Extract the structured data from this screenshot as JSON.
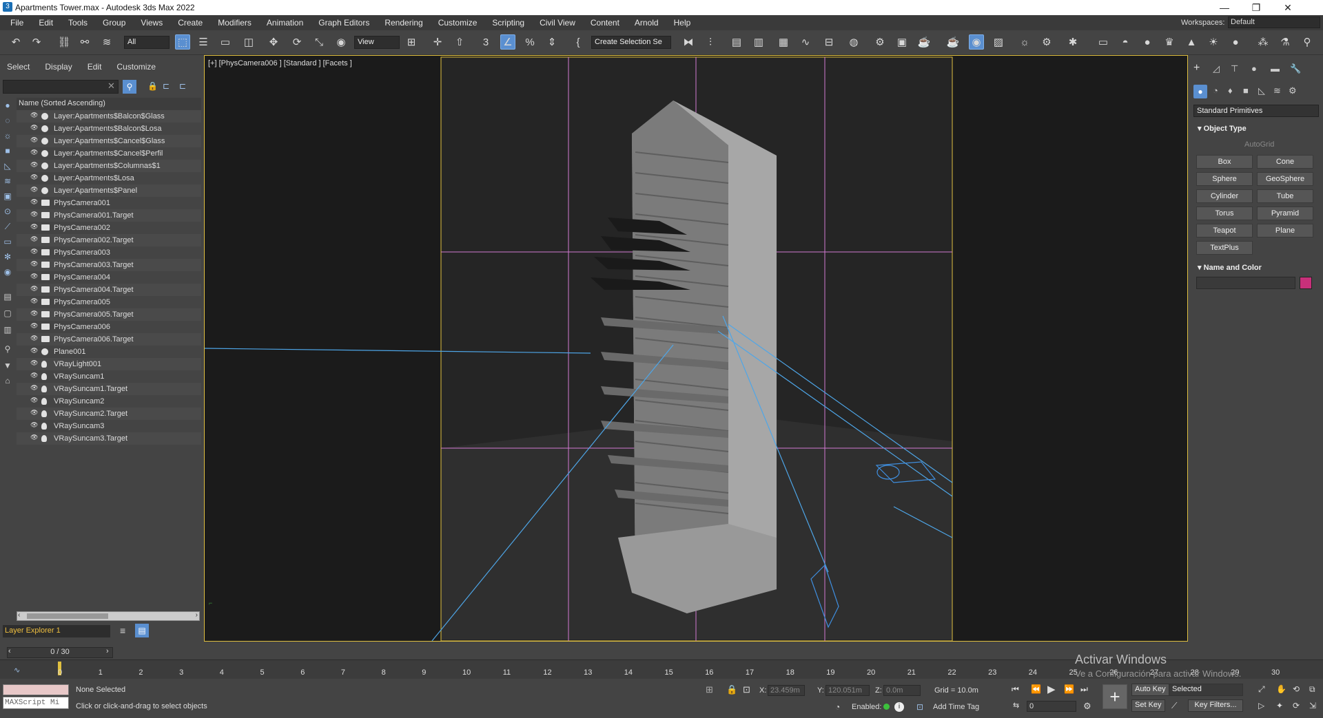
{
  "window": {
    "title": "Apartments Tower.max - Autodesk 3ds Max 2022",
    "minimize": "—",
    "restore": "❐",
    "close": "✕"
  },
  "menu": [
    "File",
    "Edit",
    "Tools",
    "Group",
    "Views",
    "Create",
    "Modifiers",
    "Animation",
    "Graph Editors",
    "Rendering",
    "Customize",
    "Scripting",
    "Civil View",
    "Content",
    "Arnold",
    "Help"
  ],
  "workspace": {
    "label": "Workspaces:",
    "value": "Default"
  },
  "toolbar": {
    "filter": "All",
    "view": "View",
    "selection_set": "Create Selection Se"
  },
  "scene_explorer": {
    "tabs": [
      "Select",
      "Display",
      "Edit",
      "Customize"
    ],
    "column_header": "Name (Sorted Ascending)",
    "items": [
      "Layer:Apartments$Balcon$Glass",
      "Layer:Apartments$Balcon$Losa",
      "Layer:Apartments$Cancel$Glass",
      "Layer:Apartments$Cancel$Perfil",
      "Layer:Apartments$Columnas$1",
      "Layer:Apartments$Losa",
      "Layer:Apartments$Panel",
      "PhysCamera001",
      "PhysCamera001.Target",
      "PhysCamera002",
      "PhysCamera002.Target",
      "PhysCamera003",
      "PhysCamera003.Target",
      "PhysCamera004",
      "PhysCamera004.Target",
      "PhysCamera005",
      "PhysCamera005.Target",
      "PhysCamera006",
      "PhysCamera006.Target",
      "Plane001",
      "VRayLight001",
      "VRaySuncam1",
      "VRaySuncam1.Target",
      "VRaySuncam2",
      "VRaySuncam2.Target",
      "VRaySuncam3",
      "VRaySuncam3.Target"
    ],
    "layer_explorer": "Layer Explorer 1"
  },
  "viewport": {
    "label": "[+] [PhysCamera006 ] [Standard ] [Facets ]"
  },
  "command_panel": {
    "category": "Standard Primitives",
    "object_type_title": "Object Type",
    "autogrid": "AutoGrid",
    "buttons": [
      "Box",
      "Cone",
      "Sphere",
      "GeoSphere",
      "Cylinder",
      "Tube",
      "Torus",
      "Pyramid",
      "Teapot",
      "Plane",
      "TextPlus"
    ],
    "name_color_title": "Name and Color",
    "object_color": "#c8307a"
  },
  "timeline": {
    "frame": "0 / 30",
    "ticks": [
      "0",
      "1",
      "2",
      "3",
      "4",
      "5",
      "6",
      "7",
      "8",
      "9",
      "10",
      "11",
      "12",
      "13",
      "14",
      "15",
      "16",
      "17",
      "18",
      "19",
      "20",
      "21",
      "22",
      "23",
      "24",
      "25",
      "26",
      "27",
      "28",
      "29",
      "30"
    ]
  },
  "status": {
    "selection": "None Selected",
    "prompt": "Click or click-and-drag to select objects",
    "maxscript": "MAXScript Mi",
    "x_label": "X:",
    "x": "23.459m",
    "y_label": "Y:",
    "y": "120.051m",
    "z_label": "Z:",
    "z": "0.0m",
    "grid": "Grid = 10.0m",
    "enabled": "Enabled:",
    "add_time_tag": "Add Time Tag",
    "auto_key": "Auto Key",
    "set_key": "Set Key",
    "key_mode": "Selected",
    "key_filters": "Key Filters...",
    "current_frame": "0"
  },
  "watermark": {
    "title": "Activar Windows",
    "subtitle": "Ve a Configuración para activar Windows."
  }
}
